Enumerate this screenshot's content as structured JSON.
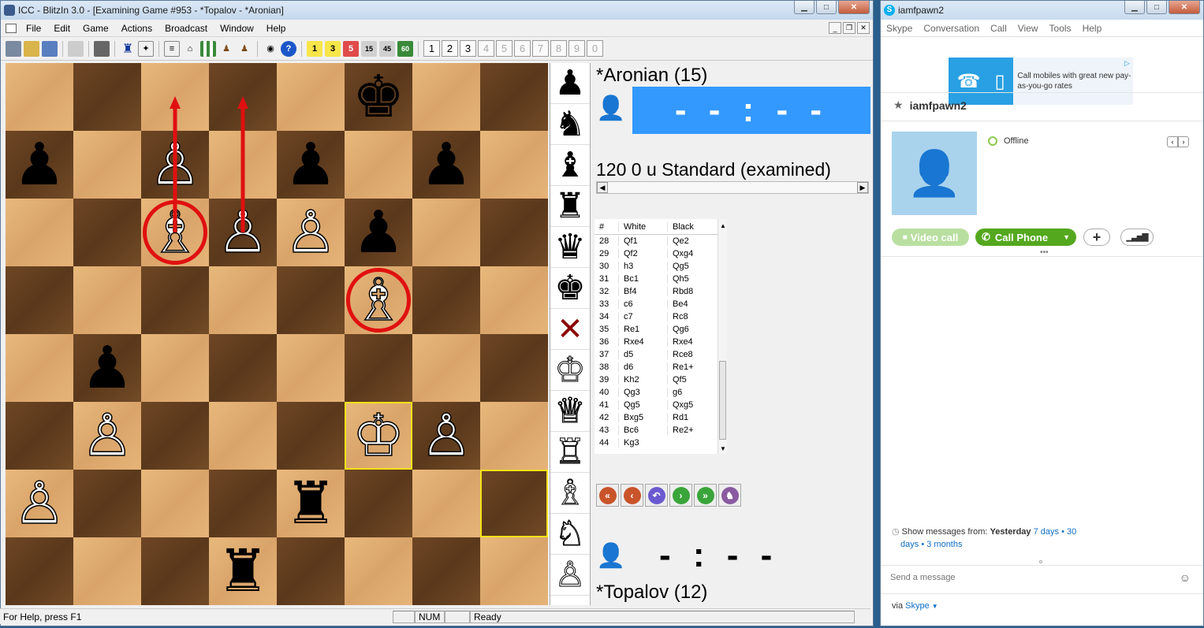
{
  "icc": {
    "title": "ICC - BlitzIn 3.0 - [Examining Game #953 - *Topalov - *Aronian]",
    "menu": [
      "File",
      "Edit",
      "Game",
      "Actions",
      "Broadcast",
      "Window",
      "Help"
    ],
    "num_buttons": [
      "1",
      "2",
      "3",
      "4",
      "5",
      "6",
      "7",
      "8",
      "9",
      "0"
    ],
    "num_disabled": [
      false,
      false,
      false,
      true,
      true,
      true,
      true,
      true,
      true,
      true
    ],
    "top_player": "*Aronian (15)",
    "top_clock": "- - : - -",
    "game_info": "120 0 u Standard (examined)",
    "bottom_clock": "- : - -",
    "bottom_player": "*Topalov (12)",
    "moves_header": {
      "num": "#",
      "white": "White",
      "black": "Black"
    },
    "moves": [
      [
        "28",
        "Qf1",
        "Qe2"
      ],
      [
        "29",
        "Qf2",
        "Qxg4"
      ],
      [
        "30",
        "h3",
        "Qg5"
      ],
      [
        "31",
        "Bc1",
        "Qh5"
      ],
      [
        "32",
        "Bf4",
        "Rbd8"
      ],
      [
        "33",
        "c6",
        "Be4"
      ],
      [
        "34",
        "c7",
        "Rc8"
      ],
      [
        "35",
        "Re1",
        "Qg6"
      ],
      [
        "36",
        "Rxe4",
        "Rxe4"
      ],
      [
        "37",
        "d5",
        "Rce8"
      ],
      [
        "38",
        "d6",
        "Re1+"
      ],
      [
        "39",
        "Kh2",
        "Qf5"
      ],
      [
        "40",
        "Qg3",
        "g6"
      ],
      [
        "41",
        "Qg5",
        "Qxg5"
      ],
      [
        "42",
        "Bxg5",
        "Rd1"
      ],
      [
        "43",
        "Bc6",
        "Re2+"
      ],
      [
        "44",
        "Kg3",
        ""
      ]
    ],
    "status": {
      "help": "For Help, press F1",
      "num": "NUM",
      "ready": "Ready"
    },
    "board": [
      [
        "",
        "",
        "",
        "",
        "",
        "bk",
        "",
        ""
      ],
      [
        "bp",
        "",
        "wp",
        "",
        "bp",
        "",
        "bp",
        ""
      ],
      [
        "",
        "",
        "wb",
        "wp",
        "wp",
        "bp",
        "",
        ""
      ],
      [
        "",
        "",
        "",
        "",
        "",
        "wb",
        "",
        ""
      ],
      [
        "",
        "bp",
        "",
        "",
        "",
        "",
        "",
        ""
      ],
      [
        "",
        "wp",
        "",
        "",
        "",
        "wk",
        "wp",
        ""
      ],
      [
        "wp",
        "",
        "",
        "",
        "br",
        "",
        "",
        ""
      ],
      [
        "",
        "",
        "",
        "br",
        "",
        "",
        "",
        ""
      ]
    ],
    "palette": [
      "black-pawn",
      "black-knight",
      "black-bishop",
      "black-rook",
      "black-queen",
      "black-king",
      "clear",
      "white-king",
      "white-queen",
      "white-rook",
      "white-bishop",
      "white-knight",
      "white-pawn"
    ],
    "colors": {
      "clock_active": "#3399ff",
      "light_square": "#e0ad72",
      "dark_square": "#65401f",
      "highlight": "#f2e21a",
      "marker": "#e01010"
    }
  },
  "skype": {
    "title": "iamfpawn2",
    "menu": [
      "Skype",
      "Conversation",
      "Call",
      "View",
      "Tools",
      "Help"
    ],
    "ad_text": "Call mobiles with great new pay-as-you-go rates",
    "contact_name": "iamfpawn2",
    "status": "Offline",
    "video_call": "Video call",
    "call_phone": "Call Phone",
    "show_messages_label": "Show messages from:",
    "show_yesterday": "Yesterday",
    "show_7days": "7 days",
    "show_30": "30",
    "show_days": "days",
    "show_3months": "3 months",
    "send_placeholder": "Send a message",
    "via_label": "via",
    "via_value": "Skype",
    "colors": {
      "green": "#54a81e",
      "green_light": "#b9dfa0",
      "link": "#0f6fc6"
    }
  }
}
